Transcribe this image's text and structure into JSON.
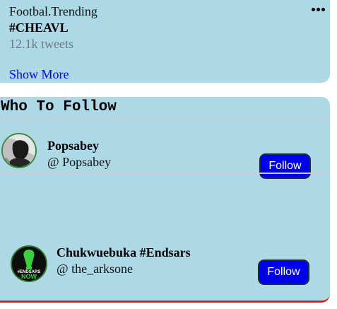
{
  "trending": {
    "category": "Footbal.Trending",
    "hashtag": "#CHEAVL",
    "tweet_count": "12.1k tweets",
    "show_more_label": "Show More"
  },
  "who_to_follow": {
    "title": "Who To Follow",
    "users": [
      {
        "name": "Popsabey",
        "handle": "@ Popsabey",
        "follow_label": "Follow"
      },
      {
        "name": "Chukwuebuka #Endsars",
        "handle": "@ the_arksone",
        "follow_label": "Follow",
        "avatar_text": [
          "#ENDSARS",
          "NOW"
        ]
      }
    ]
  },
  "colors": {
    "card_background": "#add8e6",
    "follow_button": "#0000ee",
    "link": "#0000ee",
    "bottom_border": "#e02020"
  }
}
